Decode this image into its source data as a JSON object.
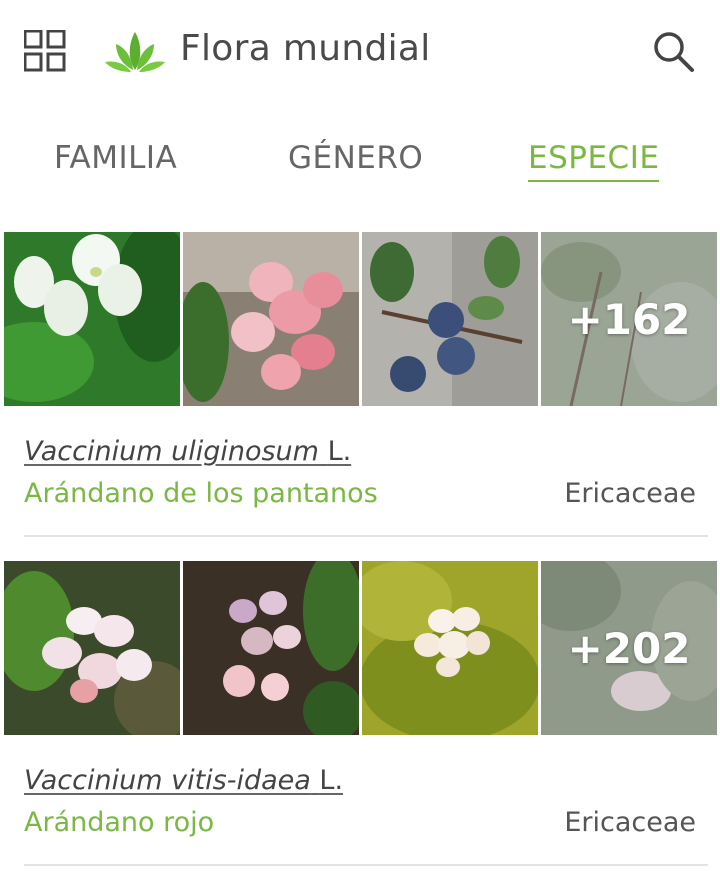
{
  "header": {
    "app_title": "Flora mundial",
    "menu_icon": "grid-icon",
    "logo_icon": "leaf-logo-icon",
    "search_icon": "search-icon"
  },
  "tabs": [
    {
      "label": "FAMILIA",
      "active": false
    },
    {
      "label": "GÉNERO",
      "active": false
    },
    {
      "label": "ESPECIE",
      "active": true
    }
  ],
  "colors": {
    "accent": "#7ab843",
    "text": "#444444",
    "divider": "#e3e3e3"
  },
  "species": [
    {
      "latin_name": "Vaccinium uliginosum",
      "author": "L.",
      "common_name": "Arándano de los pantanos",
      "family": "Ericaceae",
      "more_photos": "+162"
    },
    {
      "latin_name": "Vaccinium vitis-idaea",
      "author": "L.",
      "common_name": "Arándano rojo",
      "family": "Ericaceae",
      "more_photos": "+202"
    }
  ]
}
